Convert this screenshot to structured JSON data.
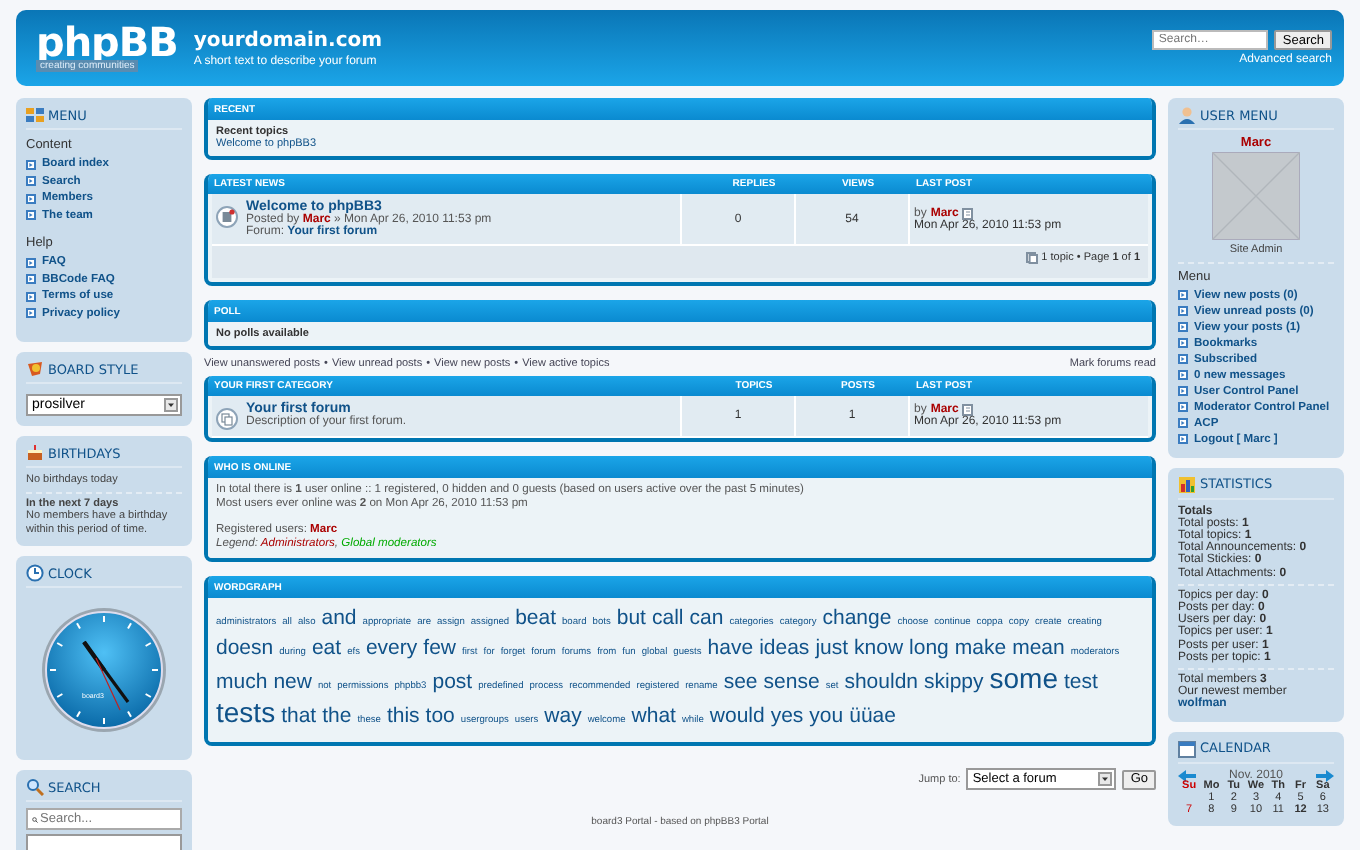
{
  "header": {
    "logo": {
      "text": "phpBB",
      "tagline": "creating communities"
    },
    "site_title": "yourdomain.com",
    "site_description": "A short text to describe your forum",
    "search": {
      "placeholder": "Search…",
      "button": "Search",
      "advanced_link": "Advanced search"
    }
  },
  "left_sidebar": {
    "menu": {
      "title": "MENU",
      "groups": [
        {
          "heading": "Content",
          "items": [
            "Board index",
            "Search",
            "Members",
            "The team"
          ]
        },
        {
          "heading": "Help",
          "items": [
            "FAQ",
            "BBCode FAQ",
            "Terms of use",
            "Privacy policy"
          ]
        }
      ]
    },
    "board_style": {
      "title": "BOARD STYLE",
      "value": "prosilver"
    },
    "birthdays": {
      "title": "BIRTHDAYS",
      "today": "No birthdays today",
      "upcoming_heading": "In the next 7 days",
      "upcoming_text": "No members have a birthday within this period of time."
    },
    "clock": {
      "title": "CLOCK",
      "face_label": "board3"
    },
    "search": {
      "title": "SEARCH",
      "placeholder": "Search..."
    }
  },
  "center": {
    "recent": {
      "title": "RECENT",
      "heading": "Recent topics",
      "topics": [
        "Welcome to phpBB3"
      ]
    },
    "latest_news": {
      "columns": [
        "LATEST NEWS",
        "REPLIES",
        "VIEWS",
        "LAST POST"
      ],
      "rows": [
        {
          "title": "Welcome to phpBB3",
          "posted_by_label": "Posted by",
          "author": "Marc",
          "posted_at": "» Mon Apr 26, 2010 11:53 pm",
          "forum_label": "Forum:",
          "forum": "Your first forum",
          "replies": "0",
          "views": "54",
          "last_by": "by",
          "last_author": "Marc",
          "last_time": "Mon Apr 26, 2010 11:53 pm"
        }
      ],
      "pagination": "1 topic • Page **1** of **1**"
    },
    "poll": {
      "title": "POLL",
      "message": "No polls available"
    },
    "quick_links": {
      "separator": "•",
      "links": [
        "View unanswered posts",
        "View unread posts",
        "View new posts",
        "View active topics"
      ],
      "mark_read": "Mark forums read"
    },
    "category": {
      "columns": [
        "YOUR FIRST CATEGORY",
        "TOPICS",
        "POSTS",
        "LAST POST"
      ],
      "forums": [
        {
          "name": "Your first forum",
          "description": "Description of your first forum.",
          "topics": "1",
          "posts": "1",
          "last_by": "by",
          "last_author": "Marc",
          "last_time": "Mon Apr 26, 2010 11:53 pm"
        }
      ]
    },
    "who_is_online": {
      "title": "WHO IS ONLINE",
      "lines": [
        "In total there is **1** user online :: 1 registered, 0 hidden and 0 guests (based on users active over the past 5 minutes)",
        "Most users ever online was **2** on Mon Apr 26, 2010 11:53 pm"
      ],
      "registered_label": "Registered users:",
      "registered_users": [
        "Marc"
      ],
      "legend_label": "Legend:",
      "legend_separator": ",",
      "legend": [
        {
          "name": "Administrators",
          "color": "#aa0000"
        },
        {
          "name": "Global moderators",
          "color": "#00aa00"
        }
      ]
    },
    "wordgraph": {
      "title": "WORDGRAPH",
      "words": [
        {
          "text": "administrators",
          "kind": "small"
        },
        {
          "text": "all",
          "kind": "small"
        },
        {
          "text": "also",
          "kind": "small"
        },
        {
          "text": "and",
          "kind": "large"
        },
        {
          "text": "appropriate",
          "kind": "small"
        },
        {
          "text": "are",
          "kind": "small"
        },
        {
          "text": "assign",
          "kind": "small"
        },
        {
          "text": "assigned",
          "kind": "small"
        },
        {
          "text": "beat",
          "kind": "large"
        },
        {
          "text": "board",
          "kind": "small"
        },
        {
          "text": "bots",
          "kind": "small"
        },
        {
          "text": "but",
          "kind": "large"
        },
        {
          "text": "call",
          "kind": "large"
        },
        {
          "text": "can",
          "kind": "large"
        },
        {
          "text": "categories",
          "kind": "small"
        },
        {
          "text": "category",
          "kind": "small"
        },
        {
          "text": "change",
          "kind": "large"
        },
        {
          "text": "choose",
          "kind": "small"
        },
        {
          "text": "continue",
          "kind": "small"
        },
        {
          "text": "coppa",
          "kind": "small"
        },
        {
          "text": "copy",
          "kind": "small"
        },
        {
          "text": "create",
          "kind": "small"
        },
        {
          "text": "creating",
          "kind": "small"
        },
        {
          "text": "doesn",
          "kind": "large"
        },
        {
          "text": "during",
          "kind": "small"
        },
        {
          "text": "eat",
          "kind": "large"
        },
        {
          "text": "efs",
          "kind": "small"
        },
        {
          "text": "every",
          "kind": "large"
        },
        {
          "text": "few",
          "kind": "large"
        },
        {
          "text": "first",
          "kind": "small"
        },
        {
          "text": "for",
          "kind": "small"
        },
        {
          "text": "forget",
          "kind": "small"
        },
        {
          "text": "forum",
          "kind": "small"
        },
        {
          "text": "forums",
          "kind": "small"
        },
        {
          "text": "from",
          "kind": "small"
        },
        {
          "text": "fun",
          "kind": "small"
        },
        {
          "text": "global",
          "kind": "small"
        },
        {
          "text": "guests",
          "kind": "small"
        },
        {
          "text": "have",
          "kind": "large"
        },
        {
          "text": "ideas",
          "kind": "large"
        },
        {
          "text": "just",
          "kind": "large"
        },
        {
          "text": "know",
          "kind": "large"
        },
        {
          "text": "long",
          "kind": "large"
        },
        {
          "text": "make",
          "kind": "large"
        },
        {
          "text": "mean",
          "kind": "large"
        },
        {
          "text": "moderators",
          "kind": "small"
        },
        {
          "text": "much",
          "kind": "large"
        },
        {
          "text": "new",
          "kind": "large"
        },
        {
          "text": "not",
          "kind": "small"
        },
        {
          "text": "permissions",
          "kind": "small"
        },
        {
          "text": "phpbb3",
          "kind": "small"
        },
        {
          "text": "post",
          "kind": "large"
        },
        {
          "text": "predefined",
          "kind": "small"
        },
        {
          "text": "process",
          "kind": "small"
        },
        {
          "text": "recommended",
          "kind": "small"
        },
        {
          "text": "registered",
          "kind": "small"
        },
        {
          "text": "rename",
          "kind": "small"
        },
        {
          "text": "see",
          "kind": "large"
        },
        {
          "text": "sense",
          "kind": "large"
        },
        {
          "text": "set",
          "kind": "small"
        },
        {
          "text": "shouldn",
          "kind": "large"
        },
        {
          "text": "skippy",
          "kind": "large"
        },
        {
          "text": "some",
          "kind": "huge"
        },
        {
          "text": "test",
          "kind": "large"
        },
        {
          "text": "tests",
          "kind": "huge"
        },
        {
          "text": "that",
          "kind": "large"
        },
        {
          "text": "the",
          "kind": "large"
        },
        {
          "text": "these",
          "kind": "small"
        },
        {
          "text": "this",
          "kind": "large"
        },
        {
          "text": "too",
          "kind": "large"
        },
        {
          "text": "usergroups",
          "kind": "small"
        },
        {
          "text": "users",
          "kind": "small"
        },
        {
          "text": "way",
          "kind": "large"
        },
        {
          "text": "welcome",
          "kind": "small"
        },
        {
          "text": "what",
          "kind": "large"
        },
        {
          "text": "while",
          "kind": "small"
        },
        {
          "text": "would",
          "kind": "large"
        },
        {
          "text": "yes",
          "kind": "large"
        },
        {
          "text": "you",
          "kind": "large"
        },
        {
          "text": "üüae",
          "kind": "large"
        }
      ]
    },
    "jump_to": {
      "label": "Jump to:",
      "value": "Select a forum",
      "button": "Go"
    },
    "footer": "board3 Portal - based on phpBB3 Portal"
  },
  "right_sidebar": {
    "user_menu": {
      "title": "USER MENU",
      "username": "Marc",
      "rank": "Site Admin",
      "menu_heading": "Menu",
      "items": [
        "View new posts (0)",
        "View unread posts (0)",
        "View your posts (1)",
        "Bookmarks",
        "Subscribed",
        "0 new messages",
        "User Control Panel",
        "Moderator Control Panel",
        "ACP",
        "Logout [ Marc ]"
      ]
    },
    "statistics": {
      "title": "STATISTICS",
      "heading": "Totals",
      "groups": [
        [
          "Total posts: **1**",
          "Total topics: **1**",
          "Total Announcements: **0**",
          "Total Stickies: **0**",
          "Total Attachments: **0**"
        ],
        [
          "Topics per day: **0**",
          "Posts per day: **0**",
          "Users per day: **0**",
          "Topics per user: **1**",
          "Posts per user: **1**",
          "Posts per topic: **1**"
        ],
        [
          "Total members **3**",
          "Our newest member"
        ]
      ],
      "newest_member": "wolfman"
    },
    "calendar": {
      "title": "CALENDAR",
      "month": "Nov. 2010",
      "weekdays": [
        "Su",
        "Mo",
        "Tu",
        "We",
        "Th",
        "Fr",
        "Sa"
      ],
      "weeks": [
        [
          {
            "kind": "blank"
          },
          {
            "day": "1",
            "today": false
          },
          {
            "day": "2",
            "today": false
          },
          {
            "day": "3",
            "today": false
          },
          {
            "day": "4",
            "today": false
          },
          {
            "day": "5",
            "today": false
          },
          {
            "day": "6",
            "today": false
          }
        ],
        [
          {
            "day": "7",
            "today": false
          },
          {
            "day": "8",
            "today": false
          },
          {
            "day": "9",
            "today": false
          },
          {
            "day": "10",
            "today": false
          },
          {
            "day": "11",
            "today": false
          },
          {
            "day": "12",
            "today": true
          },
          {
            "day": "13",
            "today": false
          }
        ]
      ]
    }
  }
}
